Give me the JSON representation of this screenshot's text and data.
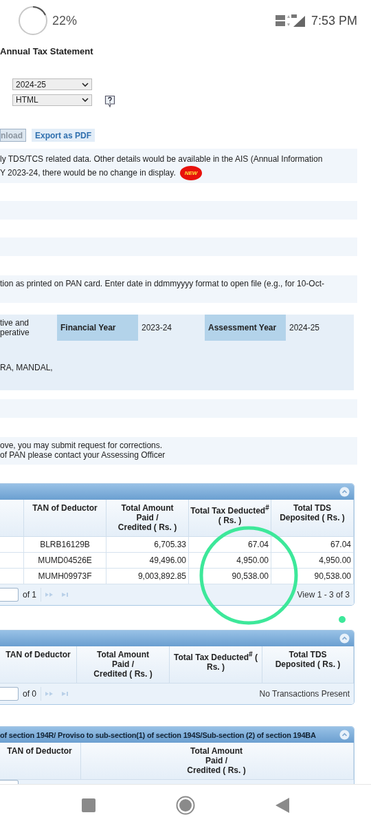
{
  "status_bar": {
    "battery": "22%",
    "time": "7:53 PM"
  },
  "page": {
    "title": "Annual Tax Statement",
    "year_select": {
      "value": "2024-25"
    },
    "format_select": {
      "value": "HTML"
    },
    "buttons": [
      {
        "label": "nload",
        "disabled": true
      },
      {
        "label": "Export as PDF",
        "disabled": false
      }
    ],
    "notice": {
      "lines": [
        "ly TDS/TCS related data. Other details would be available in the AIS (Annual Information",
        "Y 2023-24, there would be no change in display."
      ],
      "badge": "NEW"
    },
    "password_note": "tion as printed on PAN card. Enter date in ddmmyyyy format to open file (e.g., for 10-Oct-",
    "details": {
      "status_lines": [
        "tive and",
        "perative"
      ],
      "financial_year": {
        "label": "Financial Year",
        "value": "2023-24"
      },
      "assessment_year": {
        "label": "Assessment Year",
        "value": "2024-25"
      },
      "address": "RA, MANDAL,"
    },
    "correction_note": [
      "ove, you may submit request for corrections.",
      "of PAN please contact your Assessing Officer"
    ],
    "grids": [
      {
        "columns": [
          "TAN of Deductor",
          "Total Amount\nPaid /\nCredited ( Rs. )",
          "Total Tax Deducted$^{#}$\n( Rs. )",
          "Total TDS\nDeposited ( Rs. )"
        ],
        "rows": [
          [
            "BLRB16129B",
            "6,705.33",
            "67.04",
            "67.04"
          ],
          [
            "MUMD04526E",
            "49,496.00",
            "4,950.00",
            "4,950.00"
          ],
          [
            "MUMH09973F",
            "9,003,892.85",
            "90,538.00",
            "90,538.00"
          ]
        ],
        "pager": {
          "of": "of 1",
          "summary": "View 1 - 3 of 3"
        }
      },
      {
        "columns": [
          "TAN of Deductor",
          "Total Amount\nPaid /\nCredited ( Rs. )",
          "Total Tax Deducted$^{#}$ (\nRs. )",
          "Total TDS\nDeposited ( Rs. )"
        ],
        "pager": {
          "of": "of 0",
          "summary": "No Transactions Present"
        }
      },
      {
        "title": "of section 194R/ Proviso to sub-section(1) of section 194S/Sub-section (2) of section 194BA",
        "columns": [
          "TAN of Deductor",
          "Total Amount\nPaid /\nCredited ( Rs. )"
        ]
      }
    ]
  }
}
